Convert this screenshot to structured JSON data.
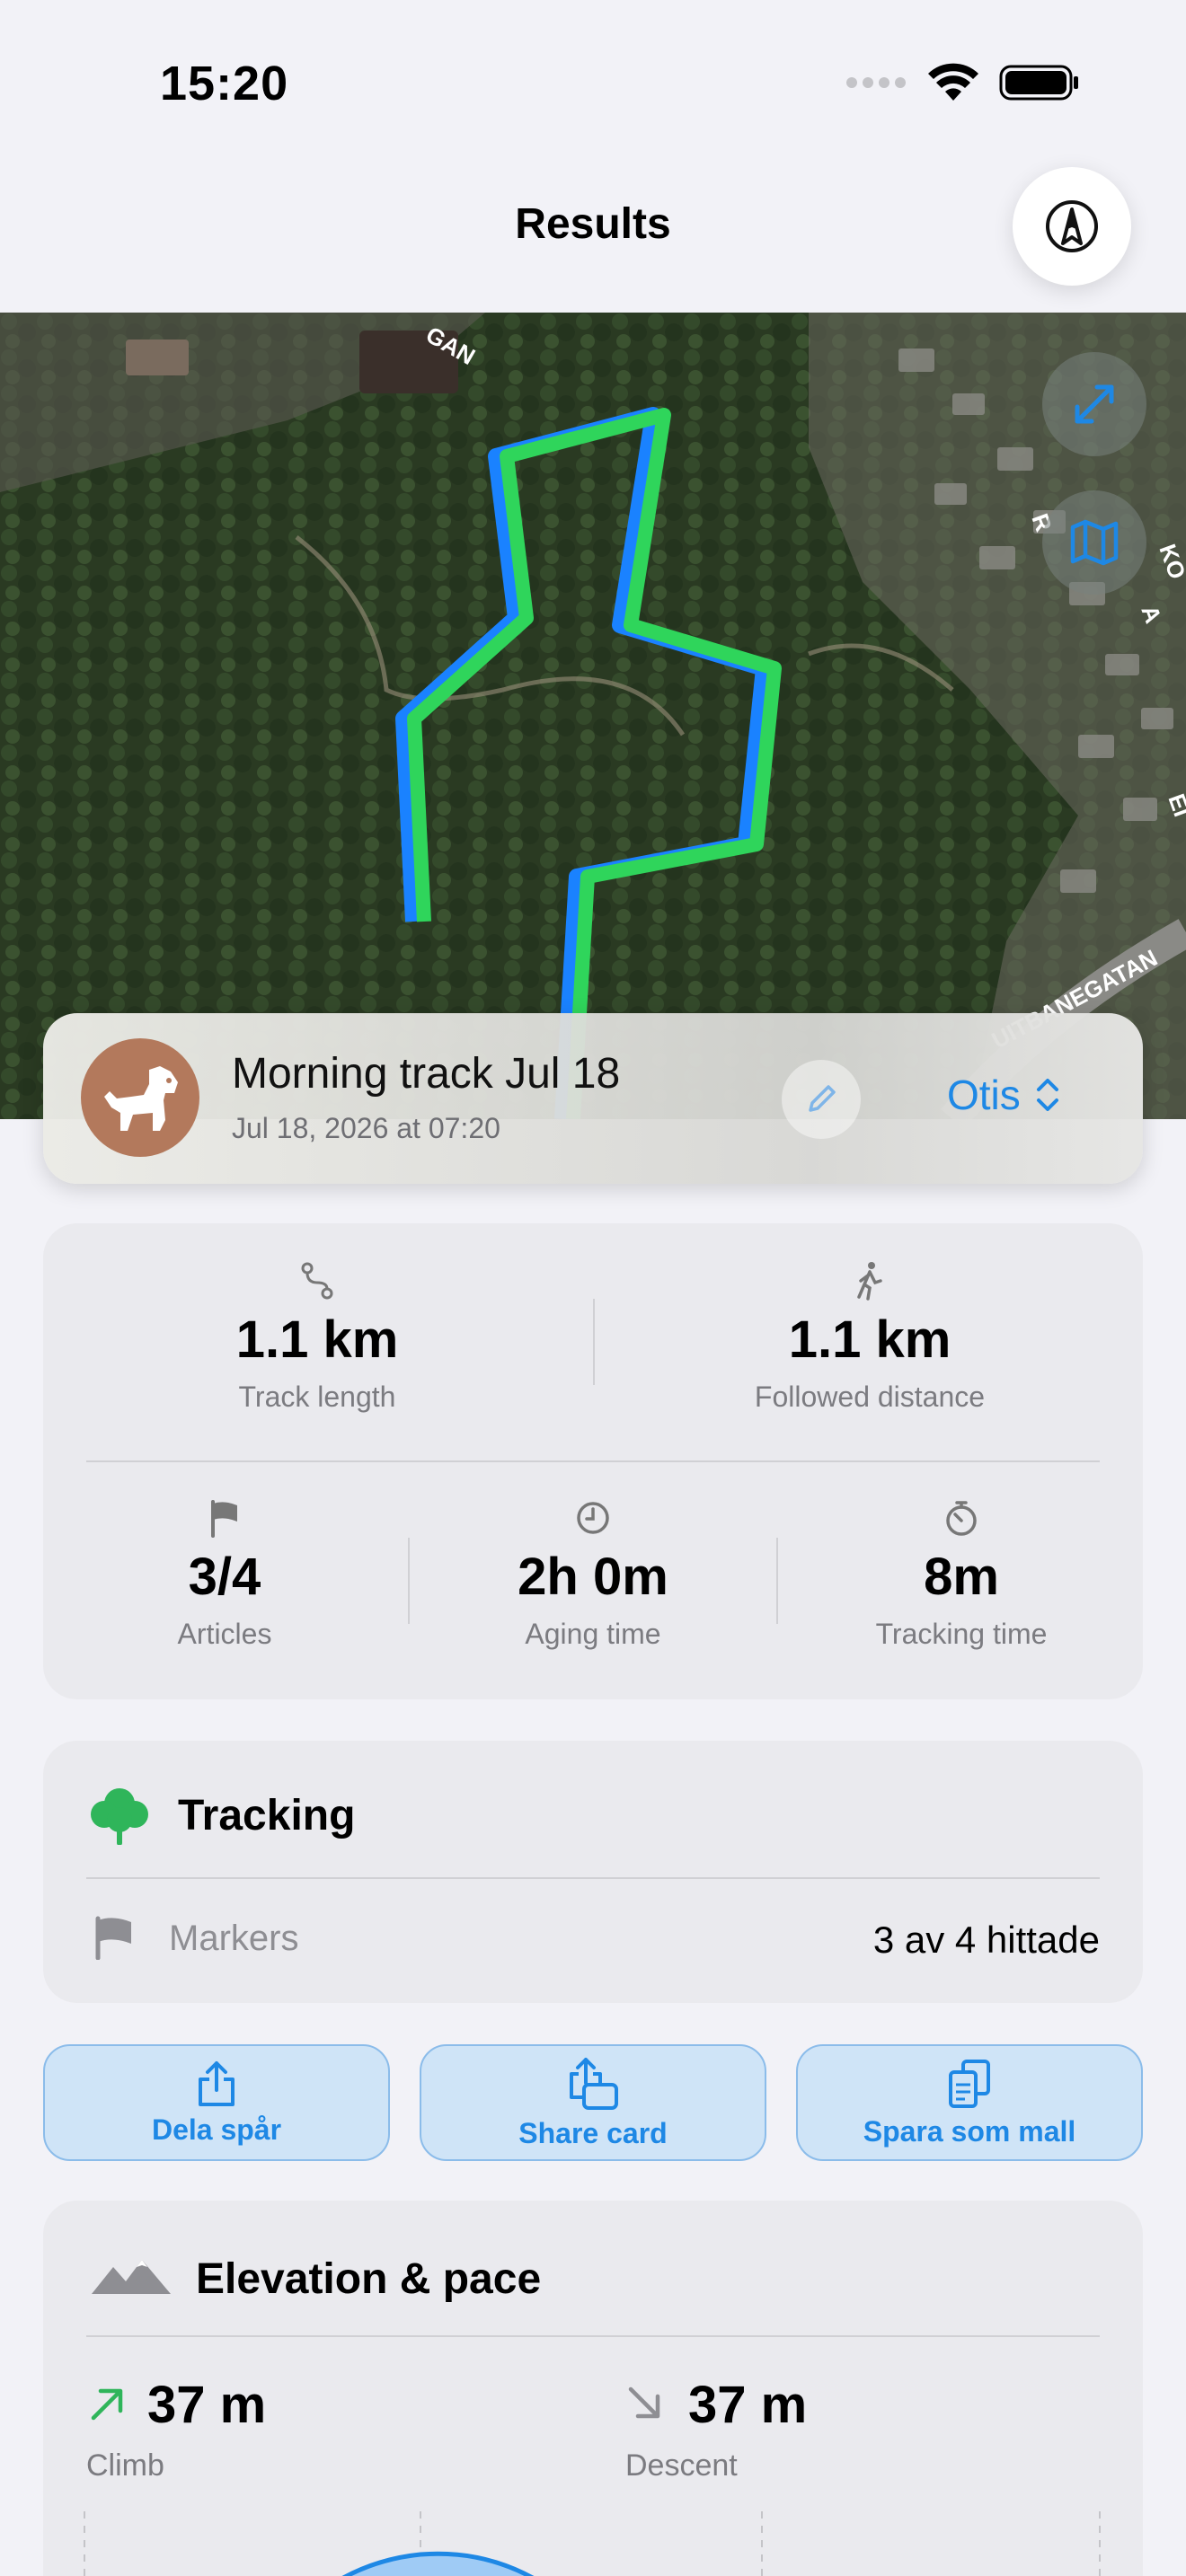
{
  "status_bar": {
    "time": "15:20"
  },
  "nav": {
    "title": "Results",
    "compass_icon": "compass-icon"
  },
  "map": {
    "expand_icon": "expand-icon",
    "map_style_icon": "map-icon",
    "street_labels": [
      "GAN",
      "UITBANEGATAN",
      "R",
      "KO",
      "A",
      "EI"
    ],
    "route_colors": {
      "followed": "#2fd55b",
      "track": "#1a82ff"
    }
  },
  "track": {
    "title": "Morning track Jul 18",
    "date": "Jul 18, 2026 at 07:20",
    "dog_name": "Otis",
    "avatar_icon": "dog-icon",
    "edit_icon": "pencil-icon"
  },
  "stats": {
    "track_length": {
      "value": "1.1 km",
      "label": "Track length"
    },
    "followed_distance": {
      "value": "1.1 km",
      "label": "Followed distance"
    },
    "articles": {
      "value": "3/4",
      "label": "Articles"
    },
    "aging_time": {
      "value": "2h 0m",
      "label": "Aging time"
    },
    "tracking_time": {
      "value": "8m",
      "label": "Tracking time"
    }
  },
  "tracking_section": {
    "title": "Tracking",
    "markers_label": "Markers",
    "markers_value": "3 av 4 hittade"
  },
  "actions": {
    "share_track": "Dela spår",
    "share_card": "Share card",
    "save_template": "Spara som mall"
  },
  "elevation": {
    "title": "Elevation & pace",
    "climb_value": "37 m",
    "climb_label": "Climb",
    "descent_value": "37 m",
    "descent_label": "Descent"
  },
  "colors": {
    "accent": "#1e88e5",
    "green": "#2fb55a"
  }
}
